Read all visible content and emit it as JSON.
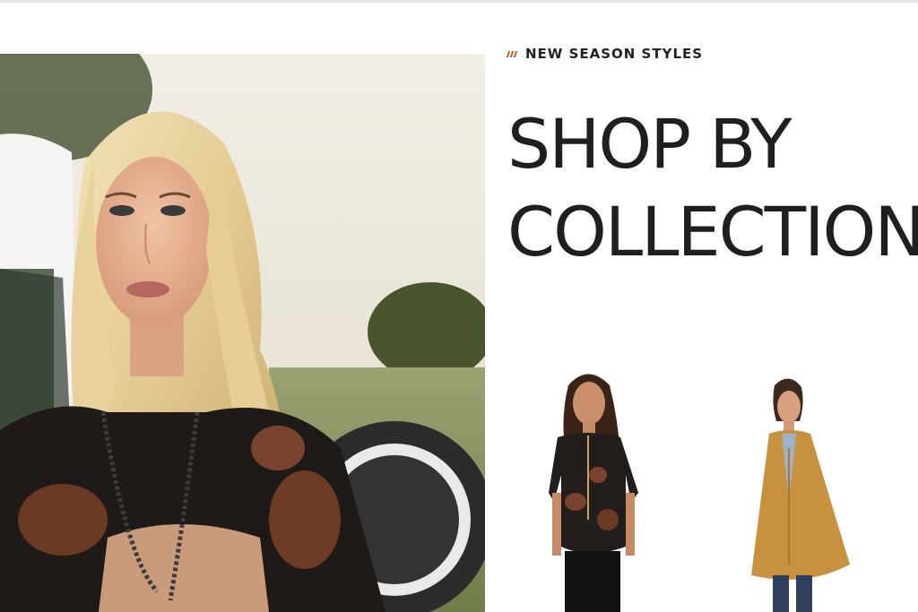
{
  "promo": {
    "eyebrow": "NEW SEASON STYLES",
    "heading_line1": "SHOP BY",
    "heading_line2": "COLLECTION"
  },
  "images": {
    "hero": "woman-with-blonde-hair-by-truck-photo",
    "products": [
      {
        "icon": "printed-shirt-model-photo"
      },
      {
        "icon": "tan-poncho-model-photo"
      }
    ]
  },
  "colors": {
    "accent": "#c0561b",
    "heading": "#1f1f1f",
    "background": "#ffffff"
  }
}
